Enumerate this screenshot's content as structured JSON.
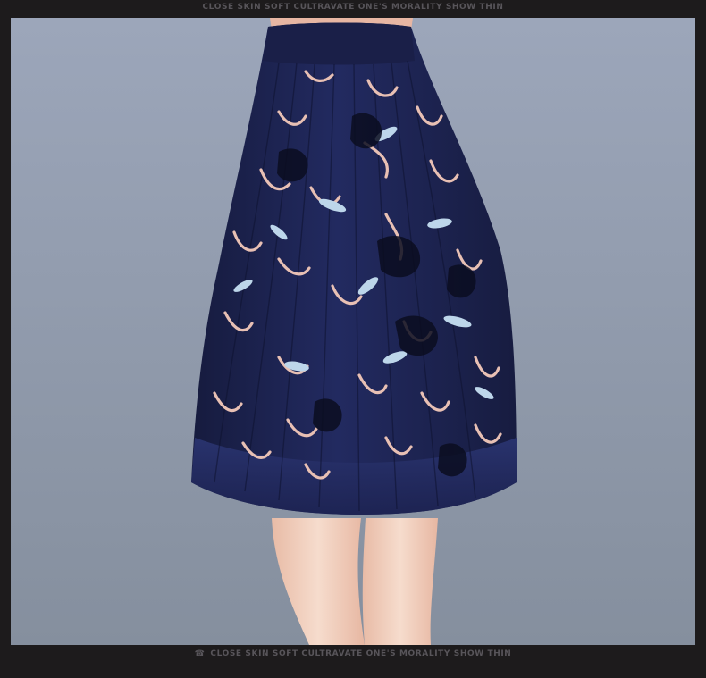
{
  "header": {
    "caption": "CLOSE SKIN SOFT CULTRAVATE ONE'S MORALITY SHOW THIN"
  },
  "footer": {
    "caption": "CLOSE SKIN SOFT CULTRAVATE ONE'S MORALITY SHOW THIN",
    "icon": "car-icon"
  },
  "colors": {
    "frame": "#1d1b1c",
    "background": "#9aa4b8",
    "skirt": "#1d2250",
    "print_pink": "#e9c2b8",
    "print_blue": "#b8d4ea",
    "skin": "#f1cdb9"
  }
}
